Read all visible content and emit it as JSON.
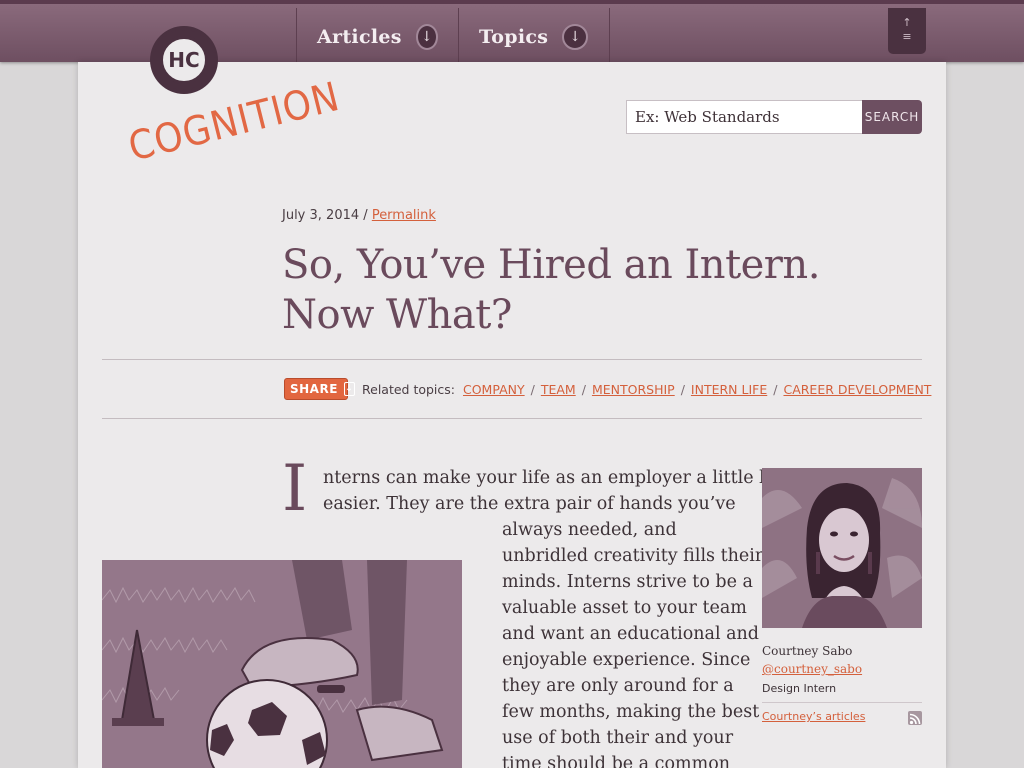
{
  "nav": {
    "items": [
      {
        "label": "Articles"
      },
      {
        "label": "Topics"
      }
    ]
  },
  "logo": {
    "monogram": "HC",
    "wordmark": "COGNITION"
  },
  "search": {
    "placeholder": "Ex: Web Standards",
    "button_label": "SEARCH"
  },
  "article": {
    "date": "July 3, 2014",
    "date_sep": "/",
    "permalink_label": "Permalink",
    "title_line1": "So, You’ve Hired an Intern.",
    "title_line2": "Now What?",
    "share_label": "SHARE",
    "related_label": "Related topics:",
    "topics": [
      "COMPANY",
      "TEAM",
      "MENTORSHIP",
      "INTERN LIFE",
      "CAREER DEVELOPMENT"
    ],
    "dropcap": "I",
    "lines": [
      "nterns can make your life as an employer a little bit",
      "easier. They are the extra pair of hands you’ve",
      "always needed, and",
      "unbridled creativity fills their",
      "minds. Interns strive to be a",
      "valuable asset to your team",
      "and want an educational and",
      "enjoyable experience. Since",
      "they are only around for a",
      "few months, making the best",
      "use of both their and your",
      "time should be a common"
    ]
  },
  "author": {
    "name": "Courtney Sabo",
    "handle": "@courtney_sabo",
    "role": "Design Intern",
    "articles_link": "Courtney’s articles"
  },
  "colors": {
    "accent": "#e2663f",
    "brand_plum": "#6a4a5c",
    "nav_bg": "#7d5d6f"
  },
  "icons": {
    "nav_arrow": "arrow-down-circle-icon",
    "menu": "menu-icon",
    "rss": "rss-icon"
  }
}
